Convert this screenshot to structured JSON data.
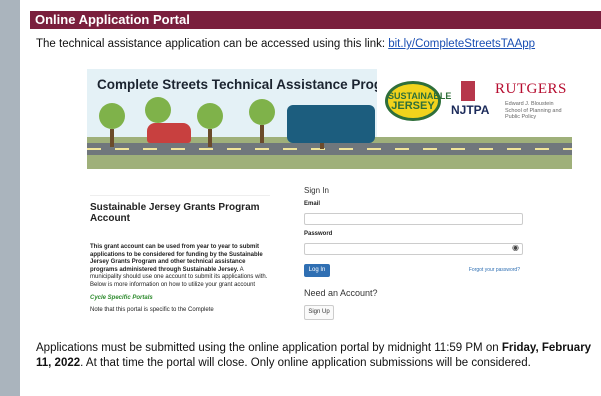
{
  "header": {
    "title": "Online Application Portal"
  },
  "intro": {
    "text": "The technical assistance application can be accessed using this link: ",
    "link": "bit.ly/CompleteStreetsTAApp"
  },
  "banner": {
    "title": "Complete Streets Technical Assistance Program",
    "sj_logo_line1": "SUSTAINABLE",
    "sj_logo_line2": "JERSEY",
    "njtpa": "NJTPA",
    "rutgers": "RUTGERS",
    "rutgers_sub": "Edward J. Bloustein School of Planning and Public Policy"
  },
  "left_panel": {
    "title": "Sustainable Jersey Grants Program Account",
    "body_bold": "This grant account can be used from year to year to submit applications to be considered for funding by the Sustainable Jersey Grants Program and other technical assistance programs administered through Sustainable Jersey.",
    "body_rest": " A municipality should use one account to submit its applications with. Below is more information on how to utilize your grant account",
    "cycle_link": "Cycle Specific Portals",
    "note": "Note that this portal is specific to the Complete"
  },
  "signin": {
    "title": "Sign In",
    "email_label": "Email",
    "password_label": "Password",
    "login_button": "Log In",
    "forgot_link": "Forgot your password?",
    "need_account": "Need an Account?",
    "signup_button": "Sign Up"
  },
  "footer": {
    "text_start": "Applications must be submitted using the online application portal by midnight 11:59 PM on ",
    "deadline": "Friday, February 11, 2022",
    "text_end": ". At that time the portal will close. Only online application submissions will be considered."
  }
}
